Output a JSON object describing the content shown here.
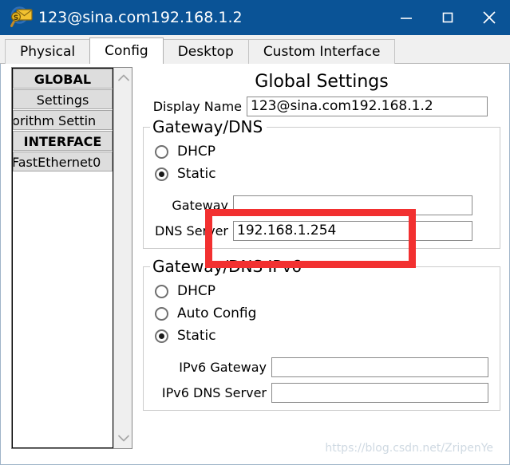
{
  "window": {
    "title": "123@sina.com192.168.1.2",
    "icon": "packet-tracer-envelope-magnifier-icon",
    "controls": {
      "minimize": "minimize-icon",
      "maximize": "maximize-icon",
      "close": "close-icon"
    },
    "titlebar_color": "#0a5396"
  },
  "tabs": [
    {
      "label": "Physical",
      "active": false
    },
    {
      "label": "Config",
      "active": true
    },
    {
      "label": "Desktop",
      "active": false
    },
    {
      "label": "Custom Interface",
      "active": false
    }
  ],
  "sidebar": {
    "items": [
      {
        "label": "GLOBAL",
        "type": "header"
      },
      {
        "label": "Settings",
        "type": "item"
      },
      {
        "label": "gorithm Settin",
        "type": "item-clipped"
      },
      {
        "label": "INTERFACE",
        "type": "header"
      },
      {
        "label": "FastEthernet0",
        "type": "item-clipped-right"
      }
    ],
    "scrollbar": {
      "up_arrow": "chevron-up-icon",
      "down_arrow": "chevron-down-icon"
    }
  },
  "main": {
    "title": "Global Settings",
    "display_name": {
      "label": "Display Name",
      "value": "123@sina.com192.168.1.2",
      "placeholder": ""
    },
    "gateway_dns": {
      "legend": "Gateway/DNS",
      "options": [
        {
          "label": "DHCP",
          "selected": false
        },
        {
          "label": "Static",
          "selected": true
        }
      ],
      "fields": [
        {
          "label": "Gateway",
          "value": "",
          "placeholder": ""
        },
        {
          "label": "DNS Server",
          "value": "192.168.1.254",
          "placeholder": ""
        }
      ]
    },
    "gateway_dns_ipv6": {
      "legend": "Gateway/DNS IPv6",
      "options": [
        {
          "label": "DHCP",
          "selected": false
        },
        {
          "label": "Auto Config",
          "selected": false
        },
        {
          "label": "Static",
          "selected": true
        }
      ],
      "fields": [
        {
          "label": "IPv6 Gateway",
          "value": "",
          "placeholder": ""
        },
        {
          "label": "IPv6 DNS Server",
          "value": "",
          "placeholder": ""
        }
      ]
    }
  },
  "annotation": {
    "type": "highlight-rectangle",
    "color": "#f23030",
    "targets": "dns-server-field"
  },
  "watermark": {
    "text": "https://blog.csdn.net/ZripenYe"
  }
}
